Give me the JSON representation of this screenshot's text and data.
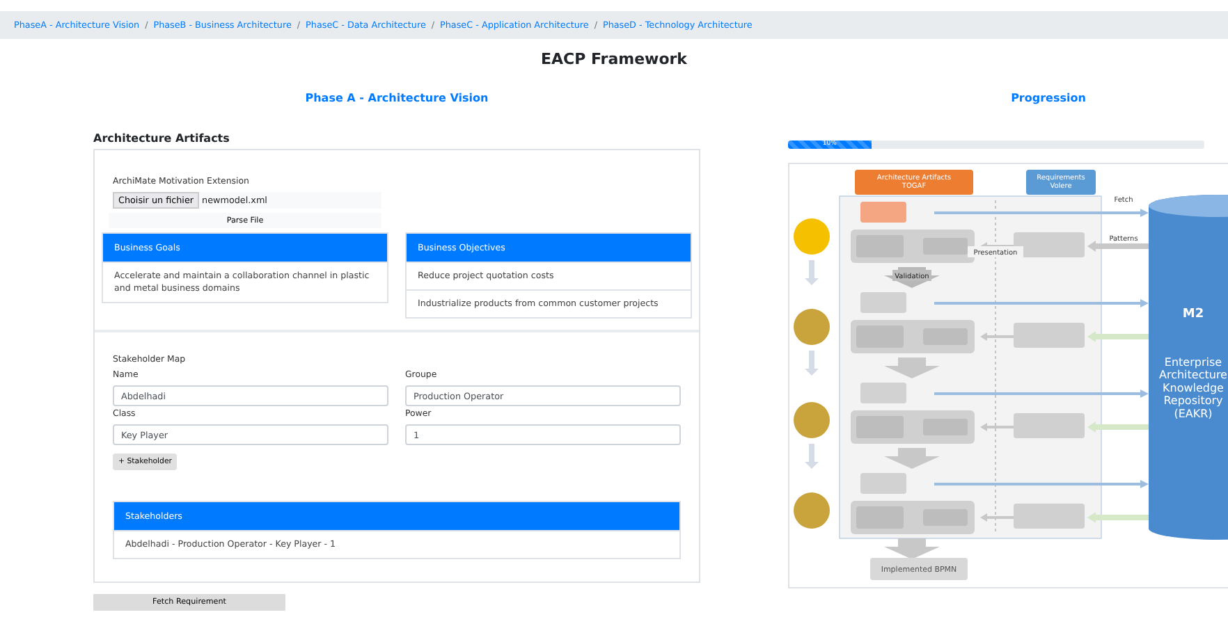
{
  "breadcrumbs": [
    "PhaseA - Architecture Vision",
    "PhaseB - Business Architecture",
    "PhaseC - Data Architecture",
    "PhaseC - Application Architecture",
    "PhaseD - Technology Architecture"
  ],
  "breadcrumb_separators": [
    "/",
    "/",
    "/",
    "/"
  ],
  "title": "EACP Framework",
  "left": {
    "heading": "Phase A -  Architecture Vision",
    "section_title": "Architecture Artifacts",
    "motivation": {
      "label": "ArchiMate Motivation Extension",
      "file_button": "Choisir un fichier",
      "file_name": "newmodel.xml",
      "parse_button": "Parse File"
    },
    "business_goals": {
      "title": "Business Goals",
      "items": [
        "Accelerate and maintain a collaboration channel in plastic and metal business domains"
      ]
    },
    "business_objectives": {
      "title": "Business Objectives",
      "items": [
        "Reduce project quotation costs",
        "Industrialize products from common customer projects"
      ]
    },
    "stakeholder_map": {
      "title": "Stakeholder Map",
      "fields": [
        {
          "label": "Name",
          "value": "Abdelhadi"
        },
        {
          "label": "Groupe",
          "value": "Production Operator"
        },
        {
          "label": "Class",
          "value": "Key Player"
        },
        {
          "label": "Power",
          "value": "1"
        }
      ],
      "add_button": "+ Stakeholder"
    },
    "stakeholders": {
      "title": "Stakeholders",
      "items": [
        "Abdelhadi - Production Operator - Key Player - 1"
      ]
    },
    "fetch_button": "Fetch Requirement"
  },
  "right": {
    "heading": "Progression",
    "progress": {
      "level": 0.2,
      "reading": "10%"
    },
    "diagram": {
      "togaf_header": [
        "Architecture Artifacts",
        "TOGAF"
      ],
      "volere_header": [
        "Requirements",
        "Volere"
      ],
      "phases": [
        {
          "selected": true
        },
        {
          "selected": false
        },
        {
          "selected": false
        },
        {
          "selected": false
        }
      ],
      "fetch_label": "Fetch",
      "patterns_label": "Patterns",
      "presentation_label": "Presentation",
      "validation_label": "Validation",
      "repository": {
        "title": "M2",
        "lines": [
          "Enterprise",
          "Architecture",
          "Knowledge",
          "Repository",
          "(EAKR)"
        ]
      },
      "output": "Implemented BPMN"
    }
  }
}
